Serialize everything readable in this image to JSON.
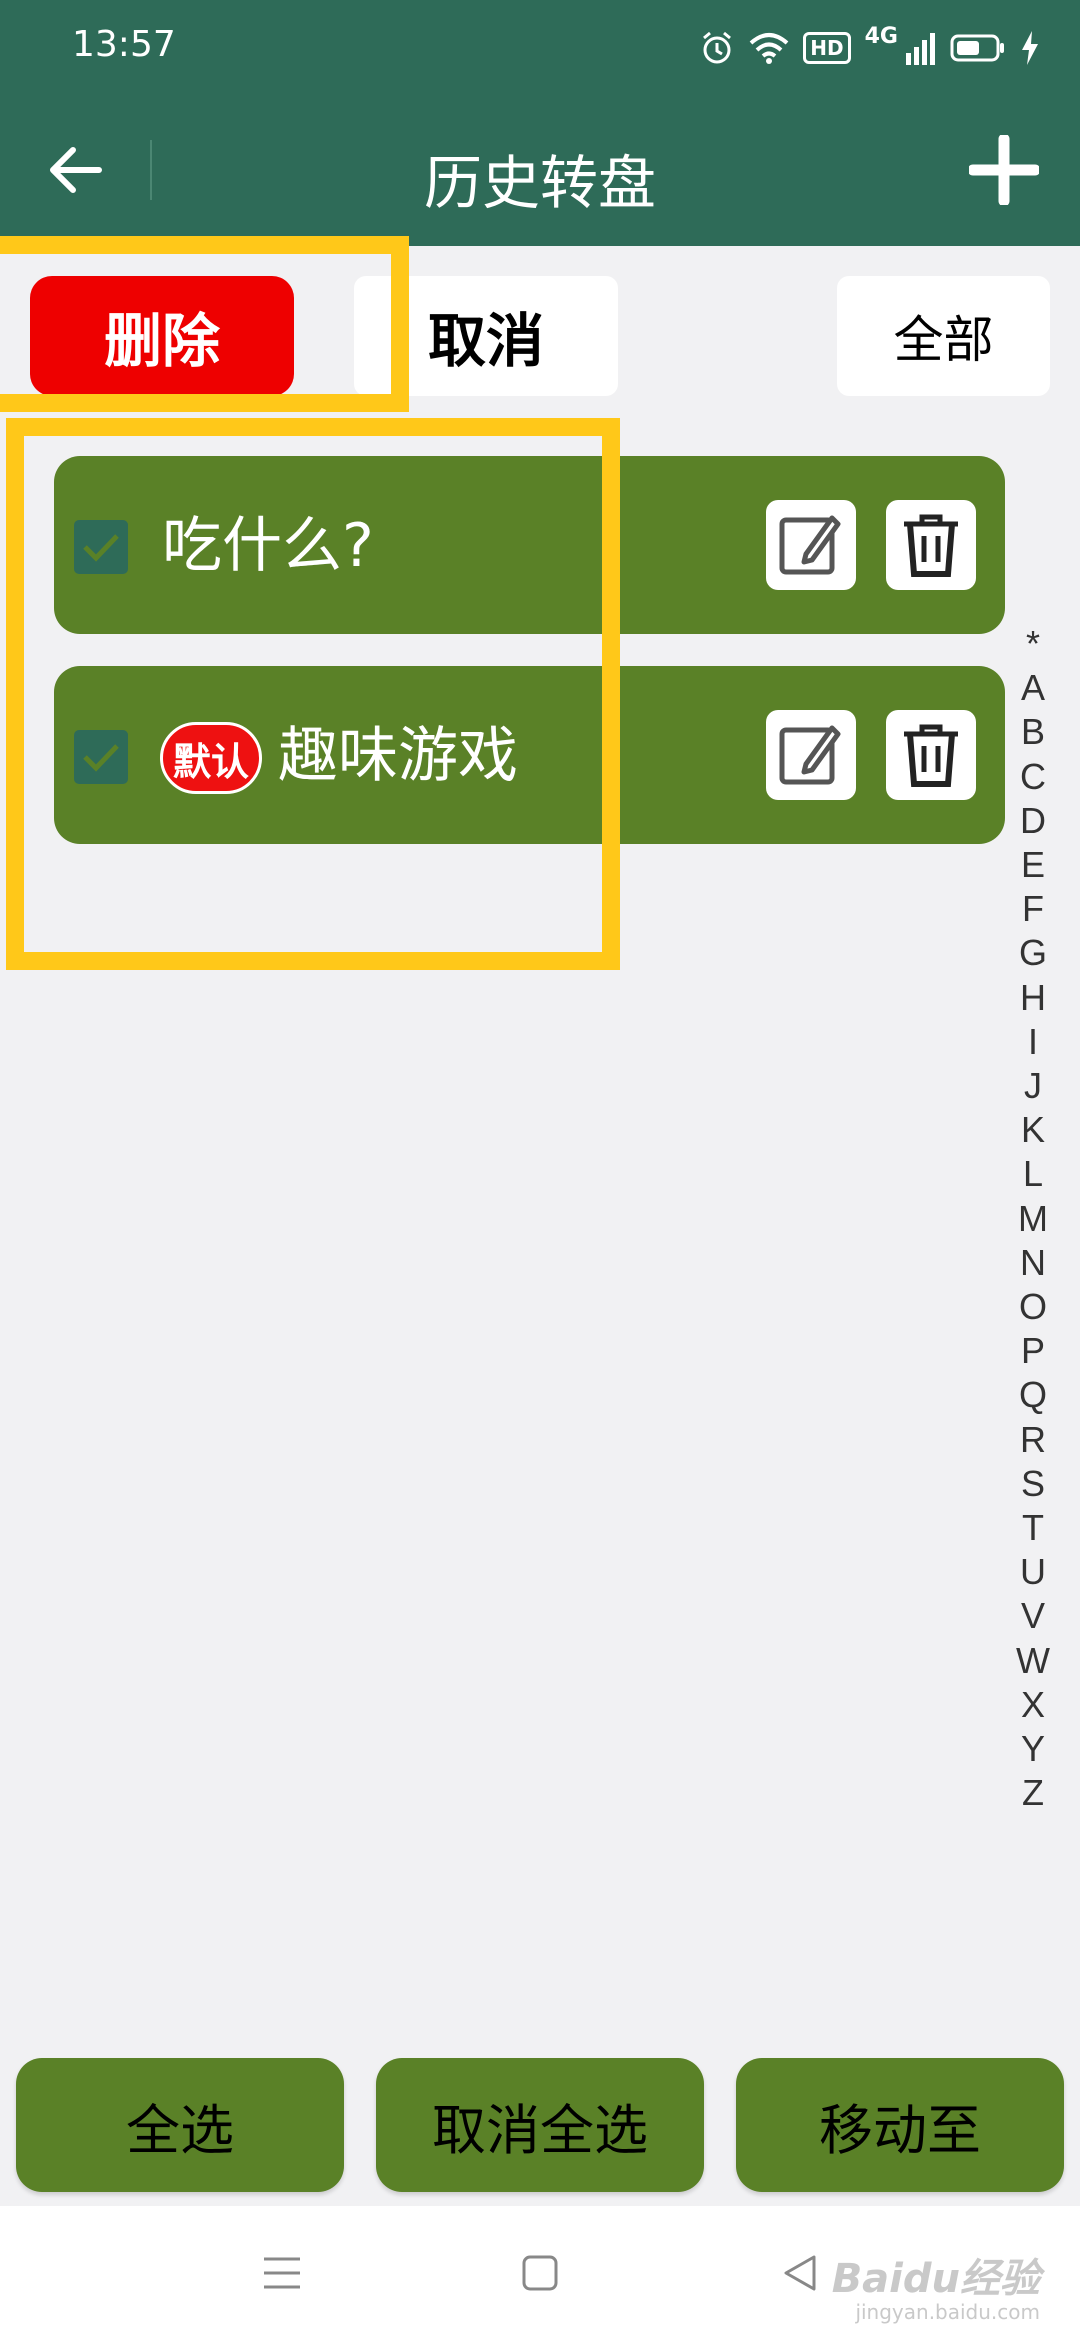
{
  "status_bar": {
    "time": "13:57",
    "hd": "HD",
    "network": "4G"
  },
  "app_bar": {
    "title": "历史转盘"
  },
  "actions": {
    "delete_label": "删除",
    "cancel_label": "取消",
    "all_label": "全部"
  },
  "items": [
    {
      "label": "吃什么?",
      "checked": true,
      "badge": ""
    },
    {
      "label": "趣味游戏",
      "checked": true,
      "badge": "默认"
    }
  ],
  "alphabet": [
    "*",
    "A",
    "B",
    "C",
    "D",
    "E",
    "F",
    "G",
    "H",
    "I",
    "J",
    "K",
    "L",
    "M",
    "N",
    "O",
    "P",
    "Q",
    "R",
    "S",
    "T",
    "U",
    "V",
    "W",
    "X",
    "Y",
    "Z"
  ],
  "bottom": {
    "select_all": "全选",
    "deselect_all": "取消全选",
    "move_to": "移动至"
  },
  "watermark": {
    "brand": "Baidu经验",
    "url": "jingyan.baidu.com"
  },
  "colors": {
    "app_bar": "#2e6b58",
    "item": "#5a8127",
    "delete": "#ee0000",
    "highlight": "#ffc819"
  }
}
